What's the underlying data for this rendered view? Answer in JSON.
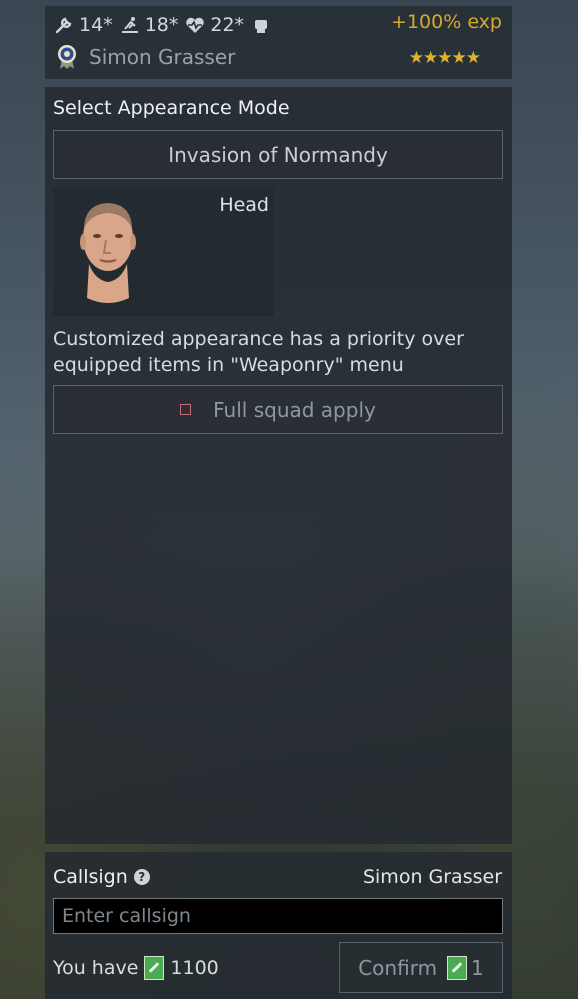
{
  "header": {
    "stats": [
      {
        "icon": "wrench-icon",
        "value": "14*"
      },
      {
        "icon": "running-soldier-icon",
        "value": "18*"
      },
      {
        "icon": "heart-rate-icon",
        "value": "22*"
      },
      {
        "icon": "fist-icon",
        "value": "•"
      }
    ],
    "exp_bonus": "+100% exp",
    "soldier_name": "Simon Grasser",
    "stars": "★★★★★"
  },
  "appearance": {
    "title": "Select Appearance Mode",
    "mode": "Invasion of Normandy",
    "head_label": "Head",
    "note": "Customized appearance has a priority over equipped items in \"Weaponry\" menu",
    "squad_apply_label": "Full squad apply",
    "squad_apply_checked": false
  },
  "callsign": {
    "label": "Callsign",
    "current": "Simon Grasser",
    "placeholder": "Enter callsign",
    "value": "",
    "balance_label": "You have",
    "balance_value": "1100",
    "confirm_label": "Confirm",
    "confirm_cost": "1"
  },
  "colors": {
    "accent_gold": "#d6a92b",
    "ticket_green": "#4caa52",
    "checkbox_pink": "#c9687a"
  }
}
